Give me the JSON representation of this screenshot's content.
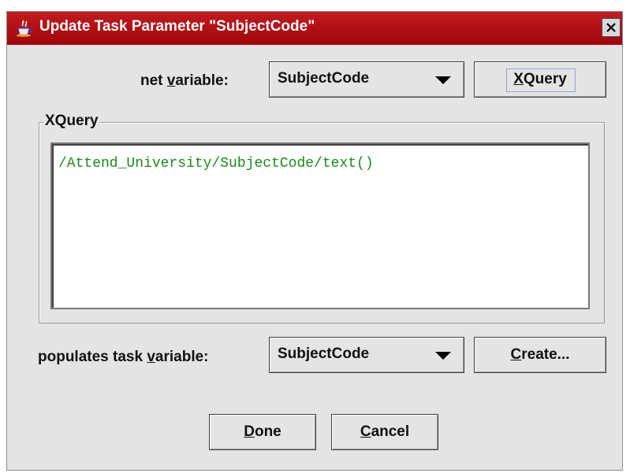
{
  "window": {
    "title": "Update Task Parameter \"SubjectCode\"",
    "app_icon": "java-cup-icon",
    "close_label": "close"
  },
  "net_variable": {
    "label_pre": "net ",
    "label_mnemonic": "v",
    "label_post": "ariable:",
    "selected": "SubjectCode"
  },
  "xquery_button": {
    "mnemonic": "X",
    "rest": "Query"
  },
  "xquery_group": {
    "legend": "XQuery",
    "expression": "/Attend_University/SubjectCode/text()"
  },
  "task_variable": {
    "label_pre": "populates task ",
    "label_mnemonic": "v",
    "label_post": "ariable:",
    "selected": "SubjectCode"
  },
  "create_button": {
    "mnemonic": "C",
    "rest": "reate..."
  },
  "done_button": {
    "mnemonic": "D",
    "rest": "one"
  },
  "cancel_button": {
    "mnemonic": "C",
    "rest": "ancel"
  },
  "colors": {
    "titlebar": "#b0101a",
    "dialog_bg": "#e4e4e4",
    "code_text": "#1a8a1a"
  }
}
